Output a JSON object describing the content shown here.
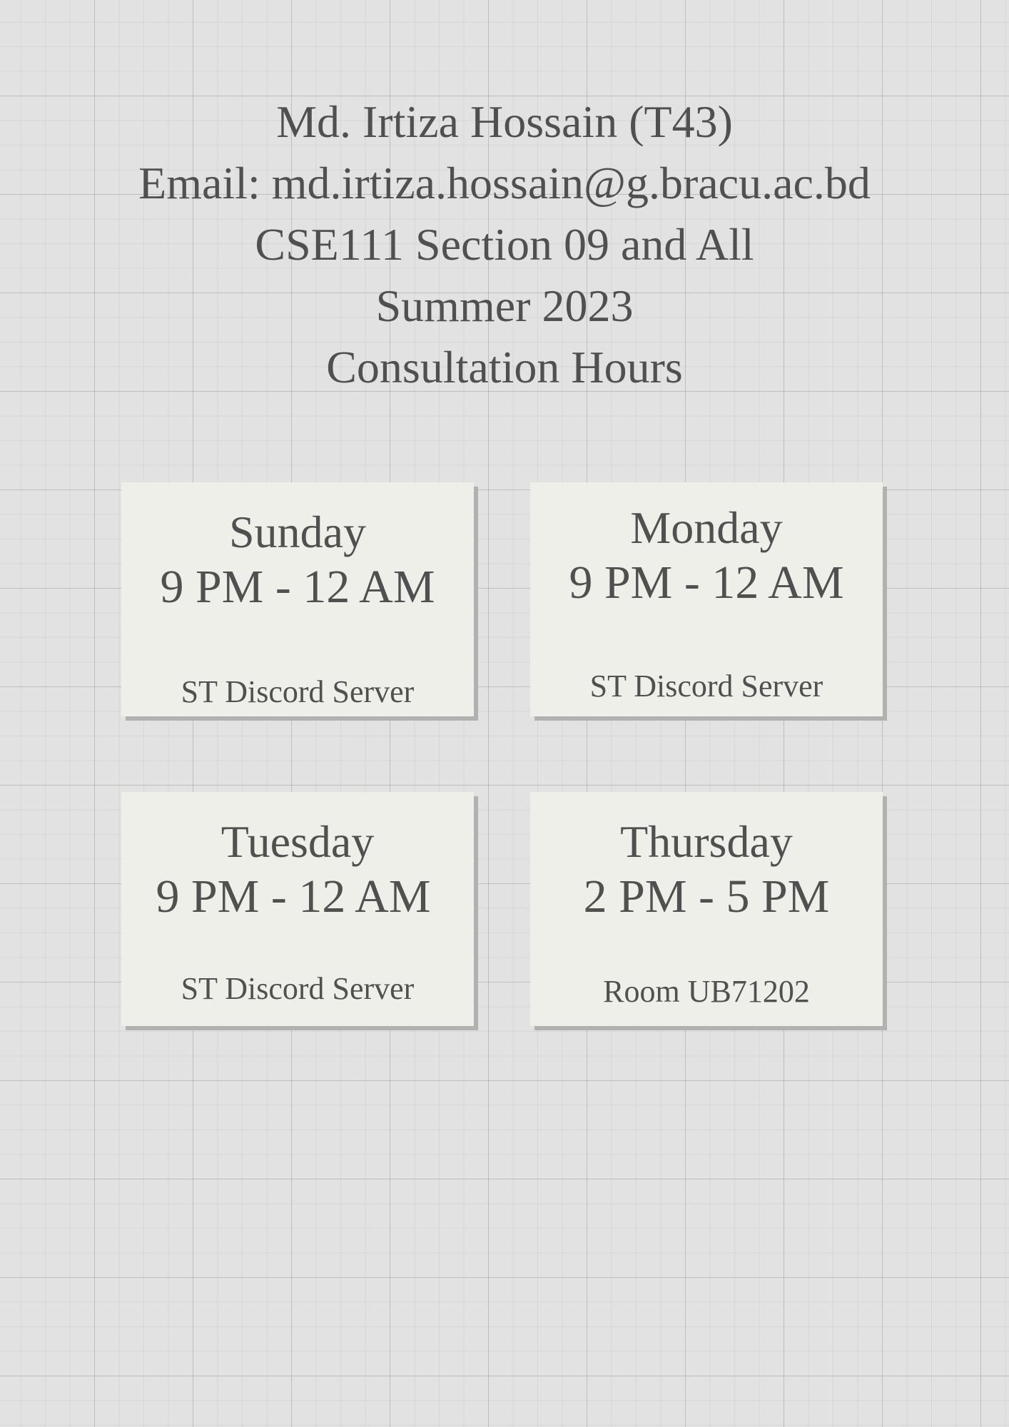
{
  "header": {
    "name": "Md. Irtiza Hossain (T43)",
    "email": "Email: md.irtiza.hossain@g.bracu.ac.bd",
    "course": "CSE111 Section 09 and All",
    "semester": "Summer 2023",
    "title": "Consultation Hours"
  },
  "schedule": [
    {
      "day": "Sunday",
      "time": "9 PM - 12 AM",
      "location": "ST Discord Server"
    },
    {
      "day": "Monday",
      "time": "9 PM - 12 AM",
      "location": "ST Discord Server"
    },
    {
      "day": "Tuesday",
      "time": "9 PM - 12 AM",
      "location": "ST Discord Server"
    },
    {
      "day": "Thursday",
      "time": "2 PM - 5 PM",
      "location": "Room UB71202"
    }
  ]
}
